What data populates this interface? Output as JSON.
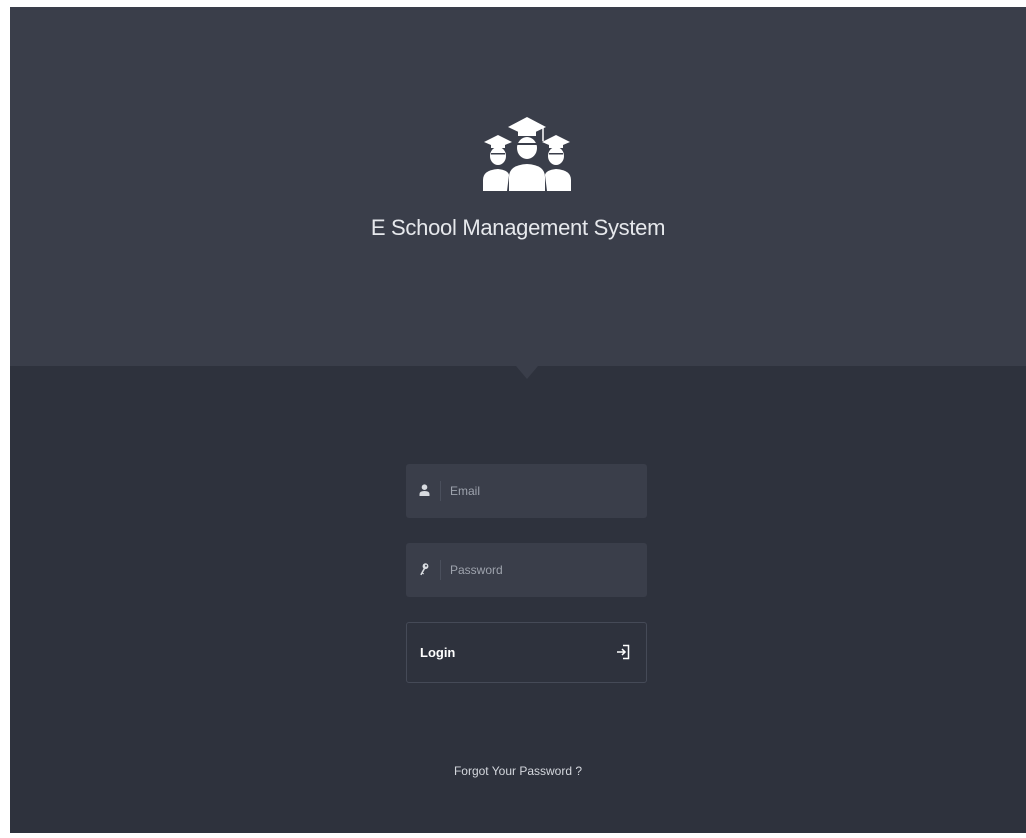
{
  "app": {
    "title": "E School Management System"
  },
  "form": {
    "email": {
      "placeholder": "Email",
      "value": "",
      "icon": "user-icon"
    },
    "password": {
      "placeholder": "Password",
      "value": "",
      "icon": "key-icon"
    },
    "login_button": {
      "label": "Login",
      "icon": "sign-in-icon"
    },
    "forgot_password_link": "Forgot Your Password ?"
  },
  "colors": {
    "page_background": "#2e323d",
    "hero_background": "#3a3e4a",
    "input_background": "#3a3e4a",
    "text_primary": "#ffffff",
    "text_muted": "#9ea3ad"
  }
}
